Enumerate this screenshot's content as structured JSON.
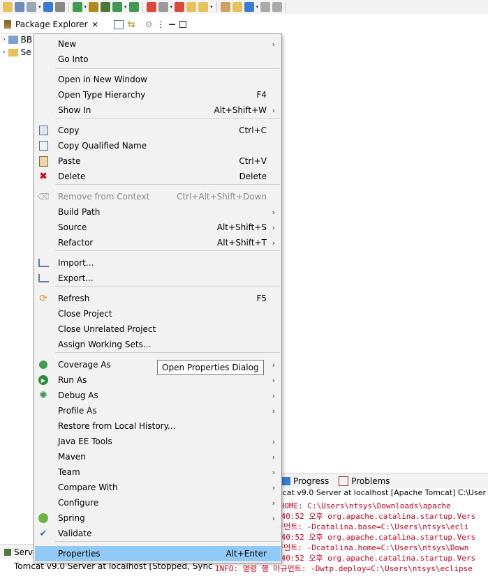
{
  "package_explorer": {
    "title": "Package Explorer",
    "tree": [
      "BB",
      "Se"
    ]
  },
  "context_menu": {
    "items": [
      {
        "label": "New",
        "accel": "",
        "submenu": true,
        "icon": ""
      },
      {
        "label": "Go Into",
        "accel": "",
        "submenu": false,
        "icon": ""
      },
      {
        "label": "Open in New Window",
        "accel": "",
        "submenu": false,
        "icon": ""
      },
      {
        "label": "Open Type Hierarchy",
        "accel": "F4",
        "submenu": false,
        "icon": ""
      },
      {
        "label": "Show In",
        "accel": "Alt+Shift+W",
        "submenu": true,
        "icon": ""
      },
      {
        "label": "Copy",
        "accel": "Ctrl+C",
        "submenu": false,
        "icon": "copy-icon"
      },
      {
        "label": "Copy Qualified Name",
        "accel": "",
        "submenu": false,
        "icon": "copy-qualified-icon"
      },
      {
        "label": "Paste",
        "accel": "Ctrl+V",
        "submenu": false,
        "icon": "paste-icon"
      },
      {
        "label": "Delete",
        "accel": "Delete",
        "submenu": false,
        "icon": "delete-icon"
      },
      {
        "label": "Remove from Context",
        "accel": "Ctrl+Alt+Shift+Down",
        "submenu": false,
        "icon": "remove-context-icon",
        "disabled": true
      },
      {
        "label": "Build Path",
        "accel": "",
        "submenu": true,
        "icon": ""
      },
      {
        "label": "Source",
        "accel": "Alt+Shift+S",
        "submenu": true,
        "icon": ""
      },
      {
        "label": "Refactor",
        "accel": "Alt+Shift+T",
        "submenu": true,
        "icon": ""
      },
      {
        "label": "Import...",
        "accel": "",
        "submenu": false,
        "icon": "import-icon"
      },
      {
        "label": "Export...",
        "accel": "",
        "submenu": false,
        "icon": "export-icon"
      },
      {
        "label": "Refresh",
        "accel": "F5",
        "submenu": false,
        "icon": "refresh-icon"
      },
      {
        "label": "Close Project",
        "accel": "",
        "submenu": false,
        "icon": ""
      },
      {
        "label": "Close Unrelated Project",
        "accel": "",
        "submenu": false,
        "icon": ""
      },
      {
        "label": "Assign Working Sets...",
        "accel": "",
        "submenu": false,
        "icon": ""
      },
      {
        "label": "Coverage As",
        "accel": "",
        "submenu": true,
        "icon": "coverage-icon"
      },
      {
        "label": "Run As",
        "accel": "",
        "submenu": true,
        "icon": "run-icon"
      },
      {
        "label": "Debug As",
        "accel": "",
        "submenu": true,
        "icon": "debug-icon"
      },
      {
        "label": "Profile As",
        "accel": "",
        "submenu": true,
        "icon": ""
      },
      {
        "label": "Restore from Local History...",
        "accel": "",
        "submenu": false,
        "icon": ""
      },
      {
        "label": "Java EE Tools",
        "accel": "",
        "submenu": true,
        "icon": ""
      },
      {
        "label": "Maven",
        "accel": "",
        "submenu": true,
        "icon": ""
      },
      {
        "label": "Team",
        "accel": "",
        "submenu": true,
        "icon": ""
      },
      {
        "label": "Compare With",
        "accel": "",
        "submenu": true,
        "icon": ""
      },
      {
        "label": "Configure",
        "accel": "",
        "submenu": true,
        "icon": ""
      },
      {
        "label": "Spring",
        "accel": "",
        "submenu": true,
        "icon": "spring-icon"
      },
      {
        "label": "Validate",
        "accel": "",
        "submenu": false,
        "icon": "validate-check-icon"
      },
      {
        "label": "Properties",
        "accel": "Alt+Enter",
        "submenu": false,
        "icon": "",
        "selected": true
      }
    ]
  },
  "tooltip": {
    "text": "Open Properties Dialog"
  },
  "bottom_panel": {
    "tabs": [
      "Progress",
      "Problems"
    ],
    "console_header": "mcat v9.0 Server at localhost [Apache Tomcat] C:\\User",
    "console_lines": [
      "_HOME:     C:\\Users\\ntsys\\Downloads\\apache",
      ":40:52 오후 org.apache.catalina.startup.Vers",
      "규먼트:  -Dcatalina.base=C:\\Users\\ntsys\\ecli",
      ":40:52 오후 org.apache.catalina.startup.Vers",
      "규먼트:  -Dcatalina.home=C:\\Users\\ntsys\\Down",
      ":40:52 오후 org.apache.catalina.startup.Vers",
      "INFO: 명령 행 아규먼트:  -Dwtp.deploy=C:\\Users\\ntsys\\eclipse"
    ]
  },
  "servers": {
    "tab": "Serve",
    "row": "Tomcat v9.0 Server at localhost  [Stopped, Synch"
  }
}
